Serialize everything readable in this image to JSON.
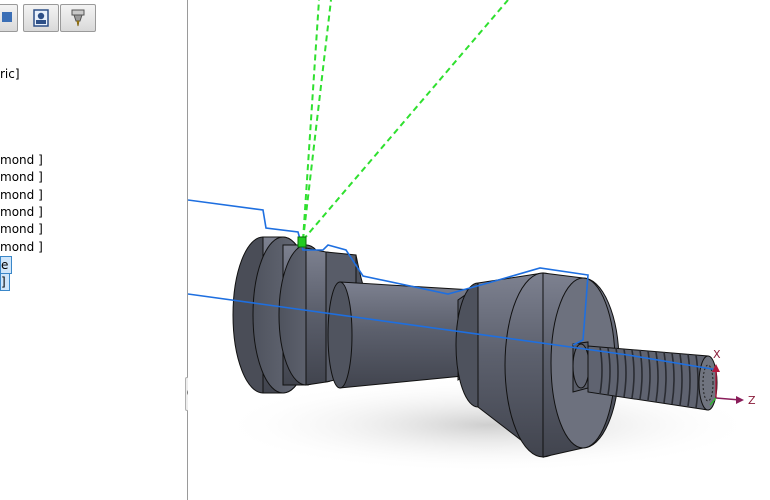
{
  "feature_tree": {
    "tabs": [
      {
        "icon": "feature-manager-icon"
      },
      {
        "icon": "camworks-feature-tree-icon"
      },
      {
        "icon": "camworks-operation-tree-icon"
      }
    ],
    "items": [
      {
        "label": "ric]",
        "selected": false
      },
      {
        "label": "mond ]",
        "selected": false
      },
      {
        "label": "mond ]",
        "selected": false
      },
      {
        "label": "mond ]",
        "selected": false
      },
      {
        "label": "mond ]",
        "selected": false
      },
      {
        "label": "mond ]",
        "selected": false
      },
      {
        "label": "mond ]",
        "selected": false
      },
      {
        "label": "e",
        "selected": true
      },
      {
        "label": "]",
        "selected": true
      }
    ]
  },
  "viewport": {
    "toolpath_color": "#1e6fe0",
    "tool_color": "#2fe02f",
    "part_color": "#5f6370",
    "axes": {
      "x_label": "X",
      "z_label": "Z",
      "x_color": "#b01a3c",
      "z_color": "#8a1d5a",
      "y_color": "#2fb52f"
    }
  }
}
